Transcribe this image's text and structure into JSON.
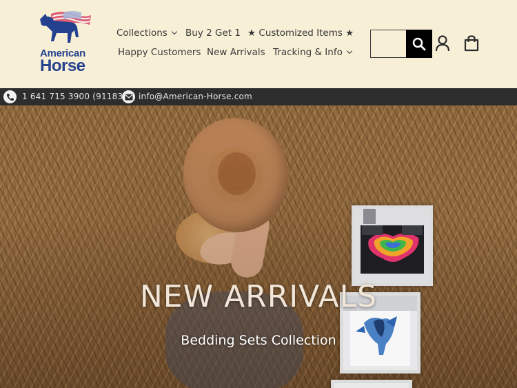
{
  "brand": {
    "name_line1": "American",
    "name_line2": "Horse",
    "logo_icon": "horse-flag-icon",
    "primary_color": "#24418f",
    "accent_color": "#d9455f"
  },
  "nav": {
    "row1": [
      {
        "label": "Collections",
        "has_dropdown": true
      },
      {
        "label": "Buy 2 Get 1",
        "has_dropdown": false
      },
      {
        "label": "★ Customized Items ★",
        "has_dropdown": false
      }
    ],
    "row2": [
      {
        "label": "Happy Customers",
        "has_dropdown": false
      },
      {
        "label": "New Arrivals",
        "has_dropdown": false
      },
      {
        "label": "Tracking & Info",
        "has_dropdown": true
      }
    ]
  },
  "search": {
    "value": "",
    "button_icon": "search-icon"
  },
  "header_icons": {
    "account": "user-icon",
    "cart": "bag-icon"
  },
  "contact": {
    "phone": "1 641 715 3900 (911835)",
    "email": "info@American-Horse.com",
    "phone_icon": "phone-icon",
    "email_icon": "mail-icon"
  },
  "hero": {
    "title": "NEW ARRIVALS",
    "subtitle": "Bedding Sets Collection"
  },
  "colors": {
    "header_bg": "#f8efd7",
    "contact_bar_bg": "#2d2d2d",
    "search_button_bg": "#000000"
  }
}
